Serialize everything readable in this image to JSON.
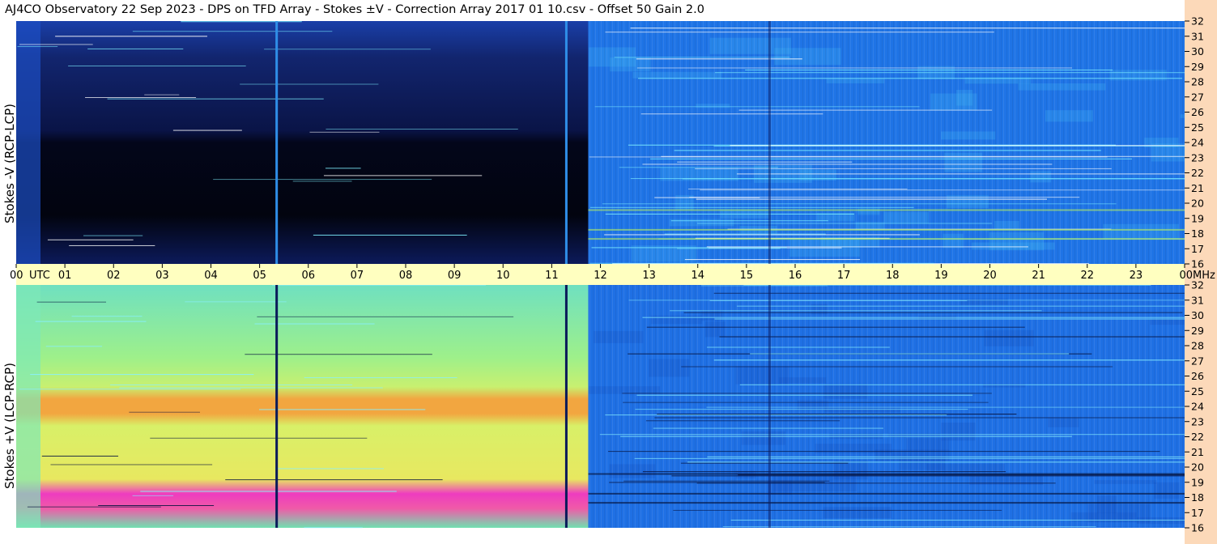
{
  "title": "AJ4CO Observatory  22 Sep 2023  -  DPS on TFD Array  -  Stokes ±V  -  Correction Array 2017 01 10.csv  -  Offset 50  Gain 2.0",
  "colors": {
    "title_bg": "#ffffff",
    "utc_band": "#ffffc0",
    "freq_strip": "#fcd9b9",
    "top_night": "#050a2a",
    "top_day": "#1f74e6",
    "bottom_night": "#7fe39a",
    "bottom_day": "#1f70e4",
    "band_orange": "#f2a640",
    "band_magenta": "#ee3cc0"
  },
  "chart_data": [
    {
      "type": "heatmap",
      "panel": "top",
      "ylabel": "Stokes -V (RCP-LCP)",
      "x_unit": "UTC",
      "y_unit": "MHz",
      "xlim": [
        0,
        24
      ],
      "ylim": [
        16,
        32
      ],
      "y_ticks": [
        "32",
        "31",
        "30",
        "29",
        "28",
        "27",
        "26",
        "25",
        "24",
        "23",
        "22",
        "21",
        "20",
        "19",
        "18",
        "17",
        "16"
      ],
      "night_end_utc": 11.75,
      "vertical_lines_utc": [
        5.35,
        11.3
      ]
    },
    {
      "type": "heatmap",
      "panel": "bottom",
      "ylabel": "Stokes +V (LCP-RCP)",
      "x_unit": "UTC",
      "y_unit": "MHz",
      "xlim": [
        0,
        24
      ],
      "ylim": [
        16,
        32
      ],
      "y_ticks": [
        "32",
        "31",
        "30",
        "29",
        "28",
        "27",
        "26",
        "25",
        "24",
        "23",
        "22",
        "21",
        "20",
        "19",
        "18",
        "17",
        "16"
      ],
      "night_end_utc": 11.75,
      "vertical_lines_utc": [
        5.35,
        11.3
      ]
    }
  ],
  "x_axis": {
    "tick_labels": [
      "00",
      "01",
      "02",
      "03",
      "04",
      "05",
      "06",
      "07",
      "08",
      "09",
      "10",
      "11",
      "12",
      "13",
      "14",
      "15",
      "16",
      "17",
      "18",
      "19",
      "20",
      "21",
      "22",
      "23",
      "00"
    ],
    "utc_label": "UTC",
    "mhz_label": "MHz"
  }
}
